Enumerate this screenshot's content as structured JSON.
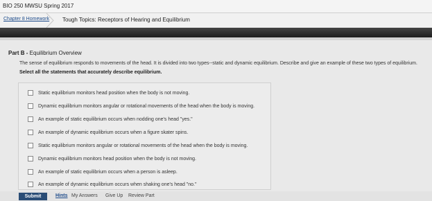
{
  "header": {
    "course_title": "BIO 250 MWSU Spring 2017"
  },
  "breadcrumb": {
    "chapter_link": "Chapter 8 Homework",
    "topic_title": "Tough Topics: Receptors of Hearing and Equilibrium"
  },
  "part": {
    "label": "Part B",
    "title": "Equilibrium Overview",
    "prompt": "The sense of equilibrium responds to movements of the head. It is divided into two types--static and dynamic equilibrium. Describe and give an example of these two types of equilibrium.",
    "instruction": "Select all the statements that accurately describe equilibrium."
  },
  "options": [
    "Static equilibrium monitors head position when the body is not moving.",
    "Dynamic equilibrium monitors angular or rotational movements of the head when the body is moving.",
    "An example of static equilibrium occurs when nodding one's head \"yes.\"",
    "An example of dynamic equilibrium occurs when a figure skater spins.",
    "Static equilibrium monitors angular or rotational movements of the head when the body is moving.",
    "Dynamic equilibrium monitors head position when the body is not moving.",
    "An example of static equilibrium occurs when a person is asleep.",
    "An example of dynamic equilibrium occurs when shaking one's head \"no.\""
  ],
  "footer": {
    "submit": "Submit",
    "hints": "Hints",
    "my_answers": "My Answers",
    "give_up": "Give Up",
    "review_part": "Review Part"
  }
}
